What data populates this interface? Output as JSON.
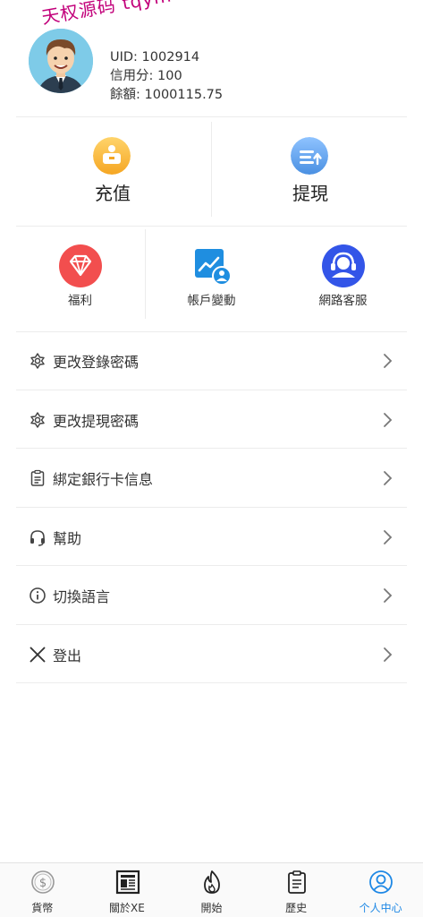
{
  "watermark": "天权源码 tqym",
  "user": {
    "uid_line": "UID: 1002914",
    "credit_line": "信用分: 100",
    "balance_line": "餘額: 1000115.75"
  },
  "quick_actions": [
    {
      "label": "充值",
      "icon": "deposit-icon"
    },
    {
      "label": "提現",
      "icon": "withdraw-icon"
    }
  ],
  "shortcuts": [
    {
      "label": "福利",
      "icon": "diamond-icon"
    },
    {
      "label": "帳戶變動",
      "icon": "account-chart-icon"
    },
    {
      "label": "網路客服",
      "icon": "headset-support-icon"
    }
  ],
  "menu": [
    {
      "label": "更改登錄密碼",
      "icon": "flower-icon"
    },
    {
      "label": "更改提現密碼",
      "icon": "flower-icon"
    },
    {
      "label": "綁定銀行卡信息",
      "icon": "clipboard-icon"
    },
    {
      "label": "幫助",
      "icon": "headphones-icon"
    },
    {
      "label": "切換語言",
      "icon": "info-icon"
    },
    {
      "label": "登出",
      "icon": "close-icon"
    }
  ],
  "tabs": [
    {
      "label": "貨幣",
      "icon": "dollar-coin-icon",
      "active": false
    },
    {
      "label": "關於XE",
      "icon": "newspaper-icon",
      "active": false
    },
    {
      "label": "開始",
      "icon": "flame-icon",
      "active": false
    },
    {
      "label": "歷史",
      "icon": "clipboard-icon",
      "active": false
    },
    {
      "label": "个人中心",
      "icon": "user-circle-icon",
      "active": true
    }
  ],
  "colors": {
    "accent": "#1e88e5",
    "deposit": "#f5a623",
    "withdraw": "#4a90e2",
    "welfare": "#f24e4e",
    "account_change": "#1f8ee0",
    "support": "#3355e8"
  }
}
